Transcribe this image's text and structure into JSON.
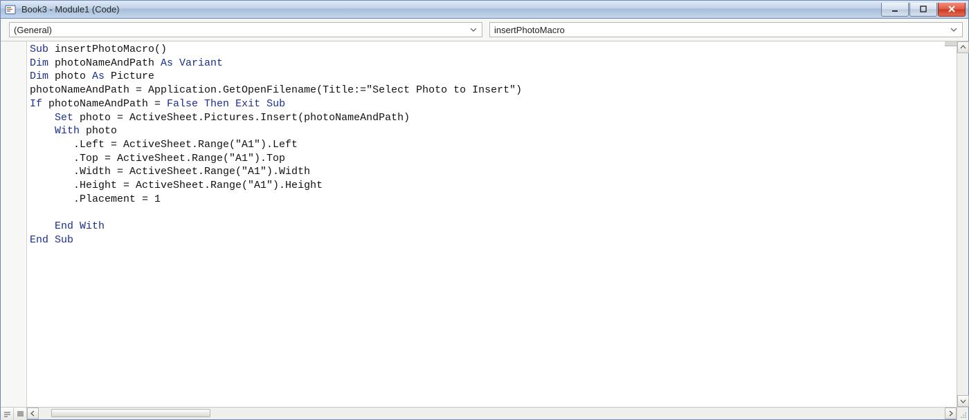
{
  "window": {
    "title": "Book3 - Module1 (Code)"
  },
  "dropdowns": {
    "left": "(General)",
    "right": "insertPhotoMacro"
  },
  "code": {
    "tokens": [
      [
        [
          "kw",
          "Sub"
        ],
        [
          "txt",
          " insertPhotoMacro()"
        ]
      ],
      [
        [
          "kw",
          "Dim"
        ],
        [
          "txt",
          " photoNameAndPath "
        ],
        [
          "kw",
          "As Variant"
        ]
      ],
      [
        [
          "kw",
          "Dim"
        ],
        [
          "txt",
          " photo "
        ],
        [
          "kw",
          "As"
        ],
        [
          "txt",
          " Picture"
        ]
      ],
      [
        [
          "txt",
          "photoNameAndPath = Application.GetOpenFilename(Title:=\"Select Photo to Insert\")"
        ]
      ],
      [
        [
          "kw",
          "If"
        ],
        [
          "txt",
          " photoNameAndPath = "
        ],
        [
          "kw",
          "False Then Exit Sub"
        ]
      ],
      [
        [
          "txt",
          "    "
        ],
        [
          "kw",
          "Set"
        ],
        [
          "txt",
          " photo = ActiveSheet.Pictures.Insert(photoNameAndPath)"
        ]
      ],
      [
        [
          "txt",
          "    "
        ],
        [
          "kw",
          "With"
        ],
        [
          "txt",
          " photo"
        ]
      ],
      [
        [
          "txt",
          "       .Left = ActiveSheet.Range(\"A1\").Left"
        ]
      ],
      [
        [
          "txt",
          "       .Top = ActiveSheet.Range(\"A1\").Top"
        ]
      ],
      [
        [
          "txt",
          "       .Width = ActiveSheet.Range(\"A1\").Width"
        ]
      ],
      [
        [
          "txt",
          "       .Height = ActiveSheet.Range(\"A1\").Height"
        ]
      ],
      [
        [
          "txt",
          "       .Placement = 1"
        ]
      ],
      [
        [
          "txt",
          ""
        ]
      ],
      [
        [
          "txt",
          "    "
        ],
        [
          "kw",
          "End With"
        ]
      ],
      [
        [
          "kw",
          "End Sub"
        ]
      ]
    ]
  }
}
